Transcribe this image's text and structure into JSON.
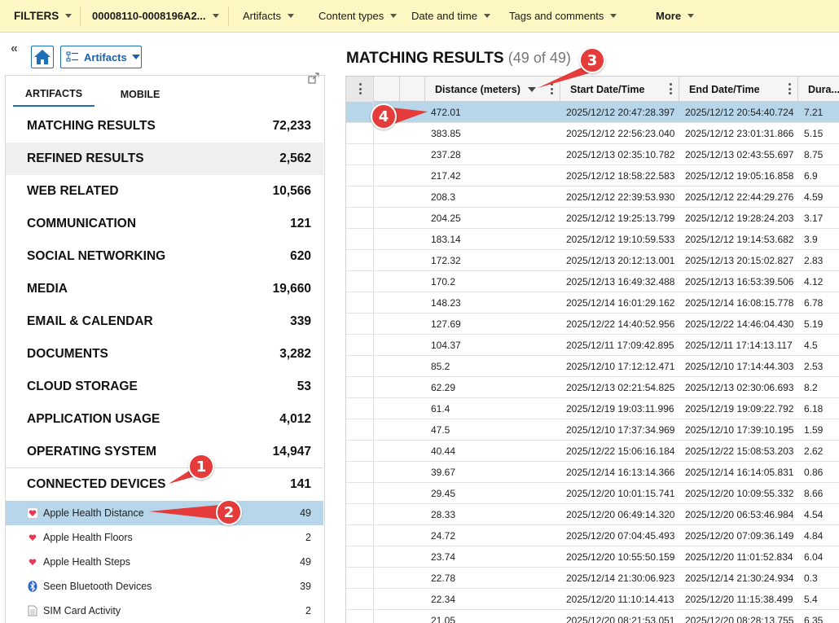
{
  "filterbar": {
    "filters_label": "FILTERS",
    "case_label": "00008110-0008196A2...",
    "artifacts_label": "Artifacts",
    "content_types_label": "Content types",
    "date_time_label": "Date and time",
    "tags_label": "Tags and comments",
    "more_label": "More"
  },
  "left": {
    "artifacts_dropdown_label": "Artifacts",
    "tabs": [
      {
        "label": "ARTIFACTS"
      },
      {
        "label": "MOBILE"
      }
    ],
    "categories": [
      {
        "label": "MATCHING RESULTS",
        "count": "72,233"
      },
      {
        "label": "REFINED RESULTS",
        "count": "2,562"
      },
      {
        "label": "WEB RELATED",
        "count": "10,566"
      },
      {
        "label": "COMMUNICATION",
        "count": "121"
      },
      {
        "label": "SOCIAL NETWORKING",
        "count": "620"
      },
      {
        "label": "MEDIA",
        "count": "19,660"
      },
      {
        "label": "EMAIL & CALENDAR",
        "count": "339"
      },
      {
        "label": "DOCUMENTS",
        "count": "3,282"
      },
      {
        "label": "CLOUD STORAGE",
        "count": "53"
      },
      {
        "label": "APPLICATION USAGE",
        "count": "4,012"
      },
      {
        "label": "OPERATING SYSTEM",
        "count": "14,947"
      },
      {
        "label": "CONNECTED DEVICES",
        "count": "141"
      }
    ],
    "subitems": [
      {
        "label": "Apple Health Distance",
        "count": "49",
        "icon": "heart-icon"
      },
      {
        "label": "Apple Health Floors",
        "count": "2",
        "icon": "heart-icon"
      },
      {
        "label": "Apple Health Steps",
        "count": "49",
        "icon": "heart-icon"
      },
      {
        "label": "Seen Bluetooth Devices",
        "count": "39",
        "icon": "bluetooth-icon"
      },
      {
        "label": "SIM Card Activity",
        "count": "2",
        "icon": "document-icon"
      }
    ]
  },
  "results": {
    "title": "MATCHING RESULTS",
    "count": "(49 of 49)",
    "columns": {
      "distance": "Distance (meters)",
      "start": "Start Date/Time",
      "end": "End Date/Time",
      "duration": "Dura..."
    },
    "rows": [
      {
        "distance": "472.01",
        "start": "2025/12/12 20:47:28.397",
        "end": "2025/12/12 20:54:40.724",
        "duration": "7.21"
      },
      {
        "distance": "383.85",
        "start": "2025/12/12 22:56:23.040",
        "end": "2025/12/12 23:01:31.866",
        "duration": "5.15"
      },
      {
        "distance": "237.28",
        "start": "2025/12/13 02:35:10.782",
        "end": "2025/12/13 02:43:55.697",
        "duration": "8.75"
      },
      {
        "distance": "217.42",
        "start": "2025/12/12 18:58:22.583",
        "end": "2025/12/12 19:05:16.858",
        "duration": "6.9"
      },
      {
        "distance": "208.3",
        "start": "2025/12/12 22:39:53.930",
        "end": "2025/12/12 22:44:29.276",
        "duration": "4.59"
      },
      {
        "distance": "204.25",
        "start": "2025/12/12 19:25:13.799",
        "end": "2025/12/12 19:28:24.203",
        "duration": "3.17"
      },
      {
        "distance": "183.14",
        "start": "2025/12/12 19:10:59.533",
        "end": "2025/12/12 19:14:53.682",
        "duration": "3.9"
      },
      {
        "distance": "172.32",
        "start": "2025/12/13 20:12:13.001",
        "end": "2025/12/13 20:15:02.827",
        "duration": "2.83"
      },
      {
        "distance": "170.2",
        "start": "2025/12/13 16:49:32.488",
        "end": "2025/12/13 16:53:39.506",
        "duration": "4.12"
      },
      {
        "distance": "148.23",
        "start": "2025/12/14 16:01:29.162",
        "end": "2025/12/14 16:08:15.778",
        "duration": "6.78"
      },
      {
        "distance": "127.69",
        "start": "2025/12/22 14:40:52.956",
        "end": "2025/12/22 14:46:04.430",
        "duration": "5.19"
      },
      {
        "distance": "104.37",
        "start": "2025/12/11 17:09:42.895",
        "end": "2025/12/11 17:14:13.117",
        "duration": "4.5"
      },
      {
        "distance": "85.2",
        "start": "2025/12/10 17:12:12.471",
        "end": "2025/12/10 17:14:44.303",
        "duration": "2.53"
      },
      {
        "distance": "62.29",
        "start": "2025/12/13 02:21:54.825",
        "end": "2025/12/13 02:30:06.693",
        "duration": "8.2"
      },
      {
        "distance": "61.4",
        "start": "2025/12/19 19:03:11.996",
        "end": "2025/12/19 19:09:22.792",
        "duration": "6.18"
      },
      {
        "distance": "47.5",
        "start": "2025/12/10 17:37:34.969",
        "end": "2025/12/10 17:39:10.195",
        "duration": "1.59"
      },
      {
        "distance": "40.44",
        "start": "2025/12/22 15:06:16.184",
        "end": "2025/12/22 15:08:53.203",
        "duration": "2.62"
      },
      {
        "distance": "39.67",
        "start": "2025/12/14 16:13:14.366",
        "end": "2025/12/14 16:14:05.831",
        "duration": "0.86"
      },
      {
        "distance": "29.45",
        "start": "2025/12/20 10:01:15.741",
        "end": "2025/12/20 10:09:55.332",
        "duration": "8.66"
      },
      {
        "distance": "28.33",
        "start": "2025/12/20 06:49:14.320",
        "end": "2025/12/20 06:53:46.984",
        "duration": "4.54"
      },
      {
        "distance": "24.72",
        "start": "2025/12/20 07:04:45.493",
        "end": "2025/12/20 07:09:36.149",
        "duration": "4.84"
      },
      {
        "distance": "23.74",
        "start": "2025/12/20 10:55:50.159",
        "end": "2025/12/20 11:01:52.834",
        "duration": "6.04"
      },
      {
        "distance": "22.78",
        "start": "2025/12/14 21:30:06.923",
        "end": "2025/12/14 21:30:24.934",
        "duration": "0.3"
      },
      {
        "distance": "22.34",
        "start": "2025/12/20 11:10:14.413",
        "end": "2025/12/20 11:15:38.499",
        "duration": "5.4"
      },
      {
        "distance": "21.05",
        "start": "2025/12/20 08:21:53.051",
        "end": "2025/12/20 08:28:13.755",
        "duration": "6.35"
      }
    ]
  },
  "callouts": [
    "1",
    "2",
    "3",
    "4"
  ],
  "colors": {
    "filterbar_bg": "#fdf7c3",
    "selection": "#b7d6ea",
    "accent": "#1e6fb8",
    "callout": "#e53b3b"
  }
}
